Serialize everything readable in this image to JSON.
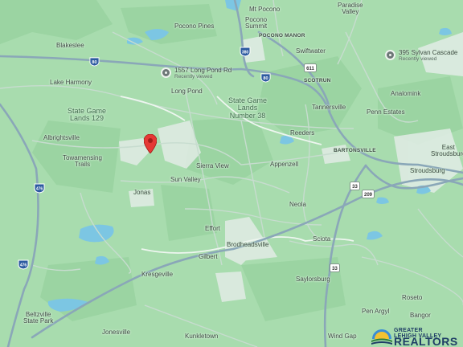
{
  "places": {
    "paradise_valley": "Paradise\nValley",
    "mt_pocono": "Mt Pocono",
    "pocono_summit": "Pocono\nSummit",
    "pocono_pines": "Pocono Pines",
    "pocono_manor": "POCONO MANOR",
    "blakeslee": "Blakeslee",
    "swiftwater": "Swiftwater",
    "lake_harmony": "Lake Harmony",
    "long_pond": "Long Pond",
    "scotrun": "SCOTRUN",
    "analomink": "Analomink",
    "tannersville": "Tannersville",
    "penn_estates": "Penn Estates",
    "reeders": "Reeders",
    "bartonsville": "BARTONSVILLE",
    "east_stroudsburg": "East\nStroudsburg",
    "stroudsburg": "Stroudsburg",
    "albrightsville": "Albrightsville",
    "towamensing_trails": "Towamensing\nTrails",
    "sierra_view": "Sierra View",
    "appenzell": "Appenzell",
    "sun_valley": "Sun Valley",
    "jonas": "Jonas",
    "neola": "Neola",
    "effort": "Effort",
    "brodheadsville": "Brodheadsville",
    "sciota": "Sciota",
    "gilbert": "Gilbert",
    "kresgeville": "Kresgeville",
    "saylorsburg": "Saylorsburg",
    "roseto": "Roseto",
    "pen_argyl": "Pen Argyl",
    "bangor": "Bangor",
    "beltzville_state_park": "Beltzville\nState Park",
    "jonesville": "Jonesville",
    "kunkletown": "Kunkletown",
    "wind_gap": "Wind Gap"
  },
  "areas": {
    "game_lands_129": "State Game\nLands 129",
    "game_lands_38": "State Game\nLands\nNumber 38"
  },
  "recent_places": [
    {
      "title": "1557 Long Pond Rd",
      "subtitle": "Recently viewed"
    },
    {
      "title": "395 Sylvan Cascade",
      "subtitle": "Recently viewed"
    }
  ],
  "route_shields": {
    "i380": "380",
    "i80_north": "80",
    "i80_east": "80",
    "i476_upper": "476",
    "i476_lower": "476",
    "r611": "611",
    "r33_upper": "33",
    "r33_lower": "33",
    "r209": "209"
  },
  "logo": {
    "line1": "GREATER\nLEHIGH VALLEY",
    "line2": "REALTORS"
  },
  "colors": {
    "land": "#a8dcae",
    "forest": "#9bd4a2",
    "light_patch": "#e2ece6",
    "road_major": "#8aa7b8",
    "road_minor": "#c7dccf",
    "water": "#7cc6e3",
    "marker": "#e53935",
    "brand": "#1f3e66"
  }
}
